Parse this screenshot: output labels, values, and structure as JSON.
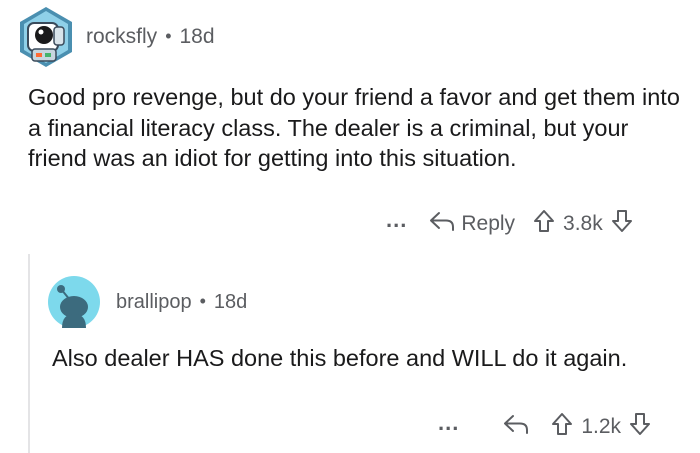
{
  "comments": [
    {
      "username": "rocksfly",
      "separator": "•",
      "age": "18d",
      "body": "Good pro revenge, but do your friend a favor and get them into a financial literacy class. The dealer is a criminal, but your friend was an idiot for getting into this situation.",
      "more_label": "...",
      "reply_label": "Reply",
      "score": "3.8k",
      "avatar_icon": "astronaut-avatar-icon"
    },
    {
      "username": "brallipop",
      "separator": "•",
      "age": "18d",
      "body": "Also dealer HAS done this before and WILL do it again.",
      "more_label": "...",
      "score": "1.2k",
      "avatar_icon": "snoo-avatar-icon"
    }
  ],
  "colors": {
    "text": "#1a1a1b",
    "meta": "#5b5d61",
    "snoo_bg": "#7dd9ec",
    "snoo_body": "#3c6b7e",
    "thread_line": "#e4e4e6"
  }
}
